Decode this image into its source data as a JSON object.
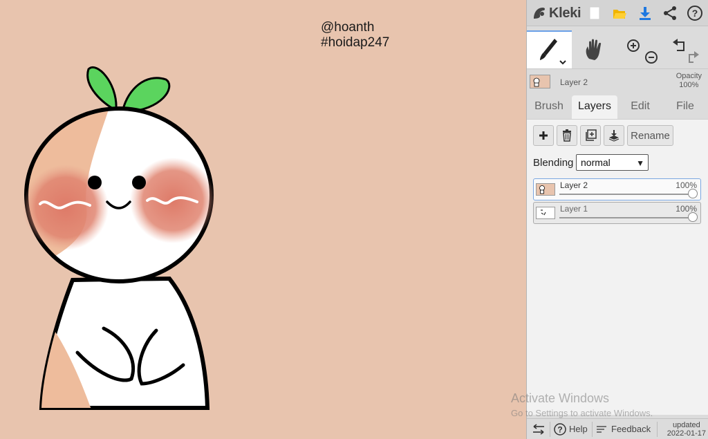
{
  "canvas": {
    "credit_line1": "@hoanth",
    "credit_line2": "#hoidap247",
    "background_color": "#e8c4ae"
  },
  "app": {
    "name": "Kleki",
    "top_icons": [
      "new-image-icon",
      "folder-open-icon",
      "download-icon",
      "share-icon",
      "help-icon"
    ]
  },
  "toolbar": {
    "tools": [
      "brush-icon",
      "hand-icon",
      "zoom-in-icon",
      "zoom-out-icon",
      "undo-icon",
      "redo-icon"
    ]
  },
  "status": {
    "layer_name": "Layer 2",
    "opacity_label": "Opacity",
    "opacity_value": "100%"
  },
  "tabs": [
    {
      "label": "Brush"
    },
    {
      "label": "Layers",
      "active": true
    },
    {
      "label": "Edit"
    },
    {
      "label": "File"
    }
  ],
  "layers_panel": {
    "rename_label": "Rename",
    "blending_label": "Blending",
    "blending_value": "normal",
    "layers": [
      {
        "name": "Layer 2",
        "opacity": "100%",
        "selected": true
      },
      {
        "name": "Layer 1",
        "opacity": "100%",
        "selected": false
      }
    ]
  },
  "bottom": {
    "help_label": "Help",
    "feedback_label": "Feedback",
    "updated_label": "updated",
    "updated_date": "2022-01-17"
  },
  "watermark": {
    "line1": "Activate Windows",
    "line2": "Go to Settings to activate Windows."
  },
  "colors": {
    "accent": "#1e78e0",
    "folder": "#f0b400",
    "leaf": "#5bd45e",
    "blush": "#de7a68",
    "peach": "#eebc9c"
  }
}
